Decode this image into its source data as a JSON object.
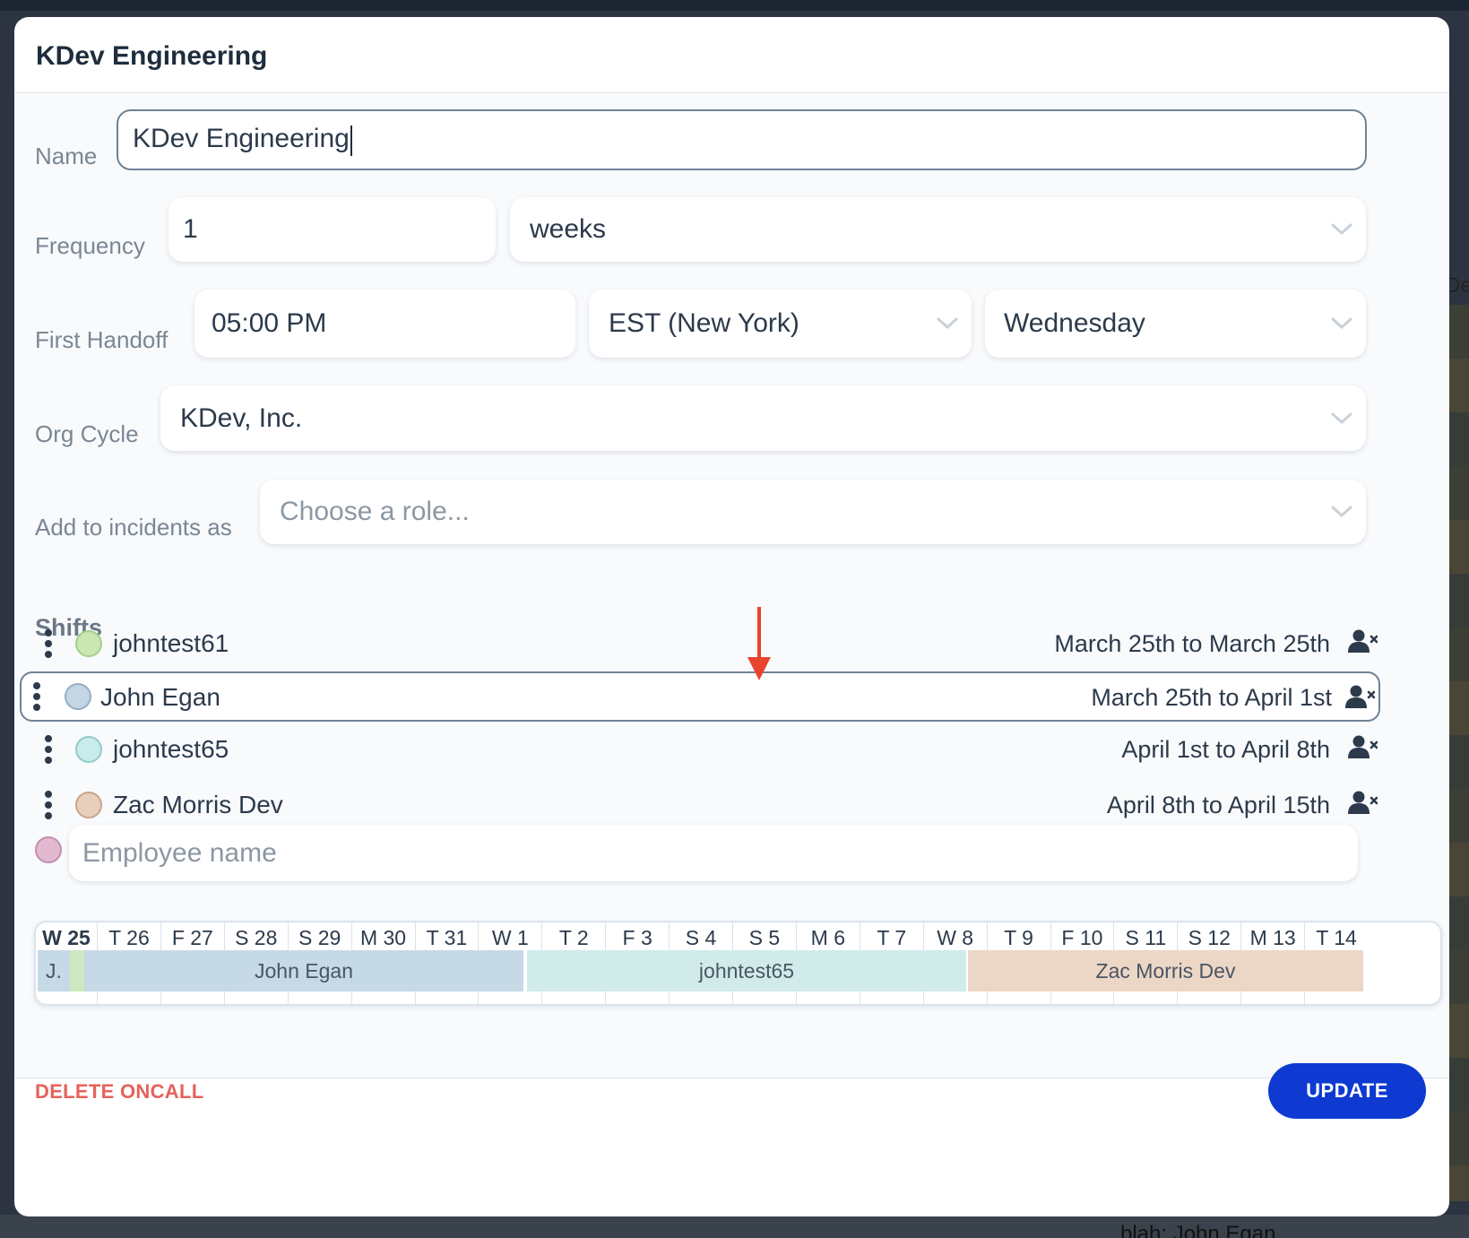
{
  "dialog": {
    "title": "KDev Engineering"
  },
  "form": {
    "name": {
      "label": "Name",
      "value": "KDev Engineering"
    },
    "frequency": {
      "label": "Frequency",
      "value": "1",
      "unit": "weeks"
    },
    "first_handoff": {
      "label": "First Handoff",
      "time": "05:00 PM",
      "timezone": "EST (New York)",
      "day": "Wednesday"
    },
    "org_cycle": {
      "label": "Org Cycle",
      "value": "KDev, Inc."
    },
    "add_to_incidents": {
      "label": "Add to incidents as",
      "placeholder": "Choose a role..."
    }
  },
  "shifts": {
    "title": "Shifts",
    "items": [
      {
        "name": "johntest61",
        "range": "March 25th to March 25th",
        "color": "#c9e6b3",
        "border": "#a6cf8a",
        "selected": false
      },
      {
        "name": "John Egan",
        "range": "March 25th to April 1st",
        "color": "#c4d5e3",
        "border": "#95aec3",
        "selected": true
      },
      {
        "name": "johntest65",
        "range": "April 1st to April 8th",
        "color": "#c9ebea",
        "border": "#8fcbca",
        "selected": false
      },
      {
        "name": "Zac Morris Dev",
        "range": "April 8th to April 15th",
        "color": "#e8cfbd",
        "border": "#c9a58a",
        "selected": false
      }
    ],
    "new_employee": {
      "placeholder": "Employee name",
      "color": "#e2b9d0",
      "border": "#c28eae"
    }
  },
  "timeline": {
    "days": [
      "W 25",
      "T 26",
      "F 27",
      "S 28",
      "S 29",
      "M 30",
      "T 31",
      "W 1",
      "T 2",
      "F 3",
      "S 4",
      "S 5",
      "M 6",
      "T 7",
      "W 8",
      "T 9",
      "F 10",
      "S 11",
      "S 12",
      "M 13",
      "T 14"
    ],
    "bars": [
      {
        "label": "J.",
        "color": "#c6d9e6"
      },
      {
        "label": "",
        "color": "#cfe8c0"
      },
      {
        "label": "John Egan",
        "color": "#c6d9e6"
      },
      {
        "label": "johntest65",
        "color": "#d0ebea"
      },
      {
        "label": "Zac Morris Dev",
        "color": "#ecd6c6"
      }
    ]
  },
  "actions": {
    "delete": "DELETE ONCALL",
    "update": "UPDATE"
  },
  "background": {
    "right_text": "De",
    "bottom_text": "blah: John Egan"
  },
  "colors": {
    "accent": "#0e3ad2",
    "danger": "#e5625c",
    "annotation_arrow": "#e8432f"
  }
}
